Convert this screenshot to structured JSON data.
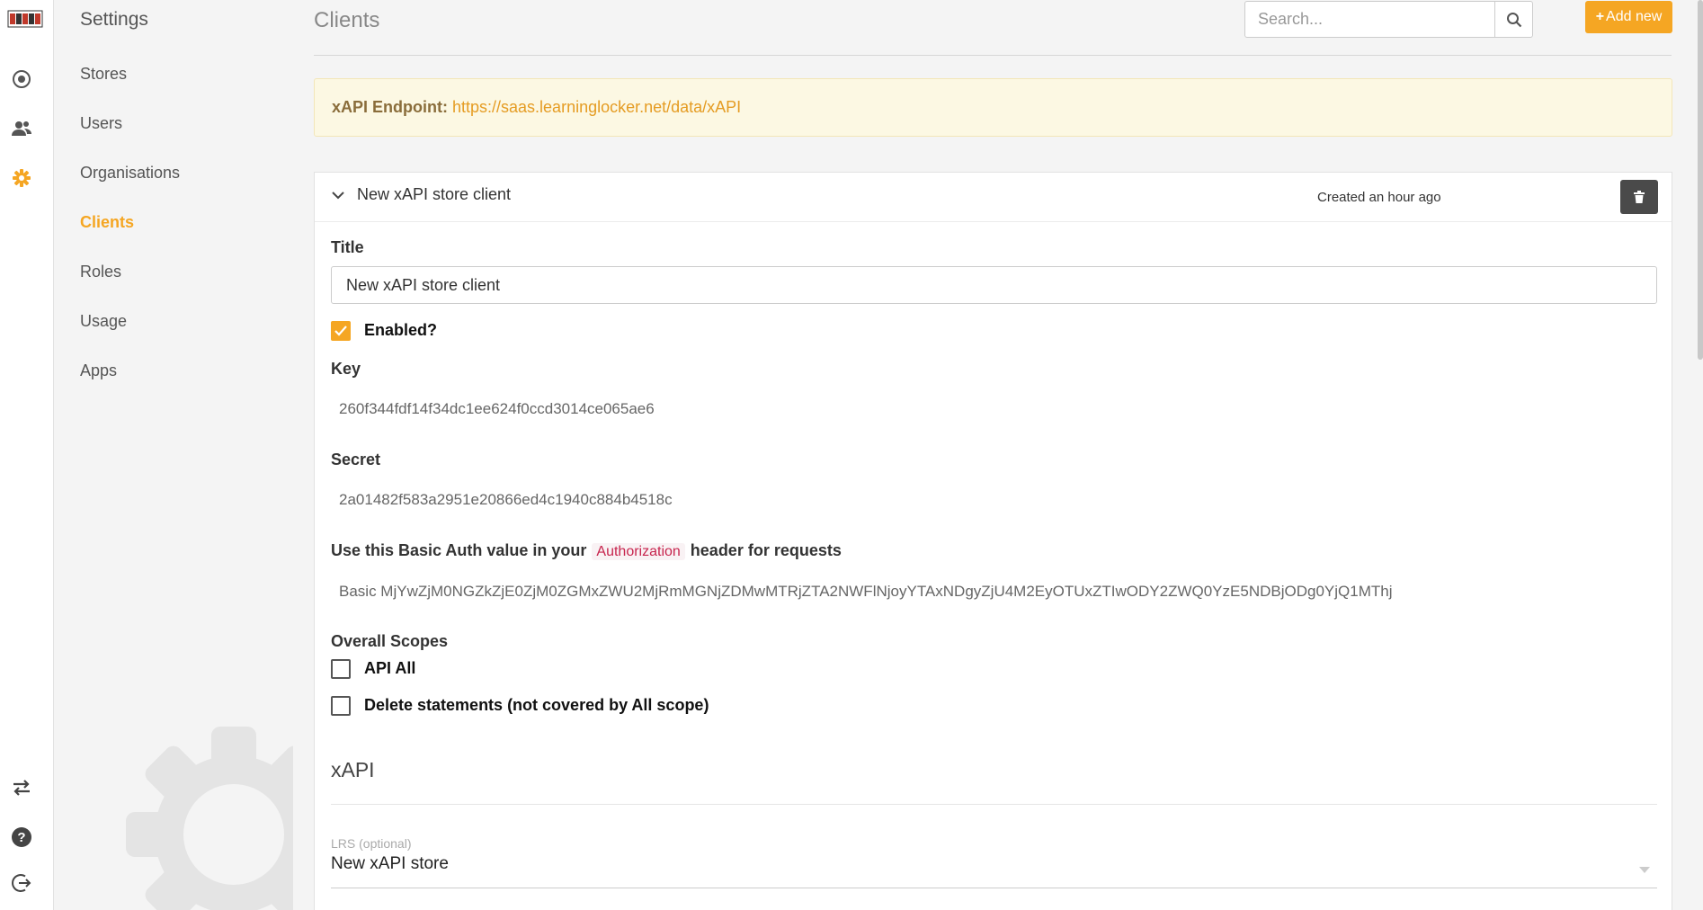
{
  "app": {
    "logo": "Learning Locker"
  },
  "rail": {
    "icons": [
      "dashboard-icon",
      "people-icon",
      "gear-icon",
      "swap-icon",
      "help-icon",
      "logout-icon"
    ],
    "accent": "#f5a623"
  },
  "subnav": {
    "title": "Settings",
    "items": [
      {
        "label": "Stores",
        "active": false
      },
      {
        "label": "Users",
        "active": false
      },
      {
        "label": "Organisations",
        "active": false
      },
      {
        "label": "Clients",
        "active": true
      },
      {
        "label": "Roles",
        "active": false
      },
      {
        "label": "Usage",
        "active": false
      },
      {
        "label": "Apps",
        "active": false
      }
    ]
  },
  "header": {
    "title": "Clients",
    "search_placeholder": "Search...",
    "add_label": "Add new"
  },
  "endpoint": {
    "label": "xAPI Endpoint:",
    "url": "https://saas.learninglocker.net/data/xAPI"
  },
  "client": {
    "name": "New xAPI store client",
    "created": "Created an hour ago",
    "title_label": "Title",
    "title_value": "New xAPI store client",
    "enabled_label": "Enabled?",
    "enabled": true,
    "key_label": "Key",
    "key": "260f344fdf14f34dc1ee624f0ccd3014ce065ae6",
    "secret_label": "Secret",
    "secret": "2a01482f583a2951e20866ed4c1940c884b4518c",
    "auth_prefix": "Use this Basic Auth value in your",
    "auth_code": "Authorization",
    "auth_suffix": "header for requests",
    "basic_auth": "Basic MjYwZjM0NGZkZjE0ZjM0ZGMxZWU2MjRmMGNjZDMwMTRjZTA2NWFlNjoyYTAxNDgyZjU4M2EyOTUxZTIwODY2ZWQ0YzE5NDBjODg0YjQ1MThj",
    "scopes_label": "Overall Scopes",
    "scopes": [
      {
        "label": "API All",
        "checked": false
      },
      {
        "label": "Delete statements (not covered by All scope)",
        "checked": false
      }
    ],
    "section_title": "xAPI",
    "lrs_label": "LRS (optional)",
    "lrs_value": "New xAPI store"
  }
}
